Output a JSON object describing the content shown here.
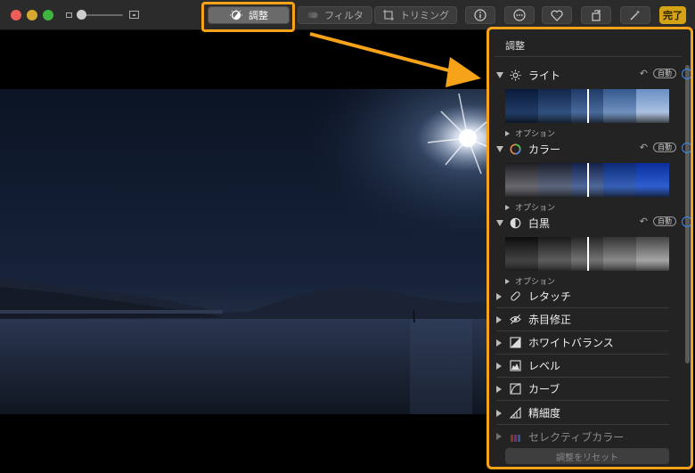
{
  "toolbar": {
    "adjust_label": "調整",
    "filter_label": "フィルタ",
    "crop_label": "トリミング",
    "done_label": "完了"
  },
  "panel": {
    "title": "調整",
    "sections": [
      {
        "label": "ライト",
        "auto": "自動",
        "option": "オプション"
      },
      {
        "label": "カラー",
        "auto": "自動",
        "option": "オプション"
      },
      {
        "label": "白黒",
        "auto": "自動",
        "option": "オプション"
      }
    ],
    "tools": [
      {
        "label": "レタッチ",
        "icon": "bandage-icon"
      },
      {
        "label": "赤目修正",
        "icon": "eye-icon"
      },
      {
        "label": "ホワイトバランス",
        "icon": "white-balance-icon"
      },
      {
        "label": "レベル",
        "icon": "levels-icon"
      },
      {
        "label": "カーブ",
        "icon": "curves-icon"
      },
      {
        "label": "精細度",
        "icon": "sharpen-icon"
      },
      {
        "label": "セレクティブカラー",
        "icon": "selective-color-icon"
      }
    ],
    "reset_label": "調整をリセット"
  },
  "colors": {
    "highlight": "#f6a31a",
    "accent_blue": "#3b8cf0",
    "done_yellow": "#d4a315"
  }
}
